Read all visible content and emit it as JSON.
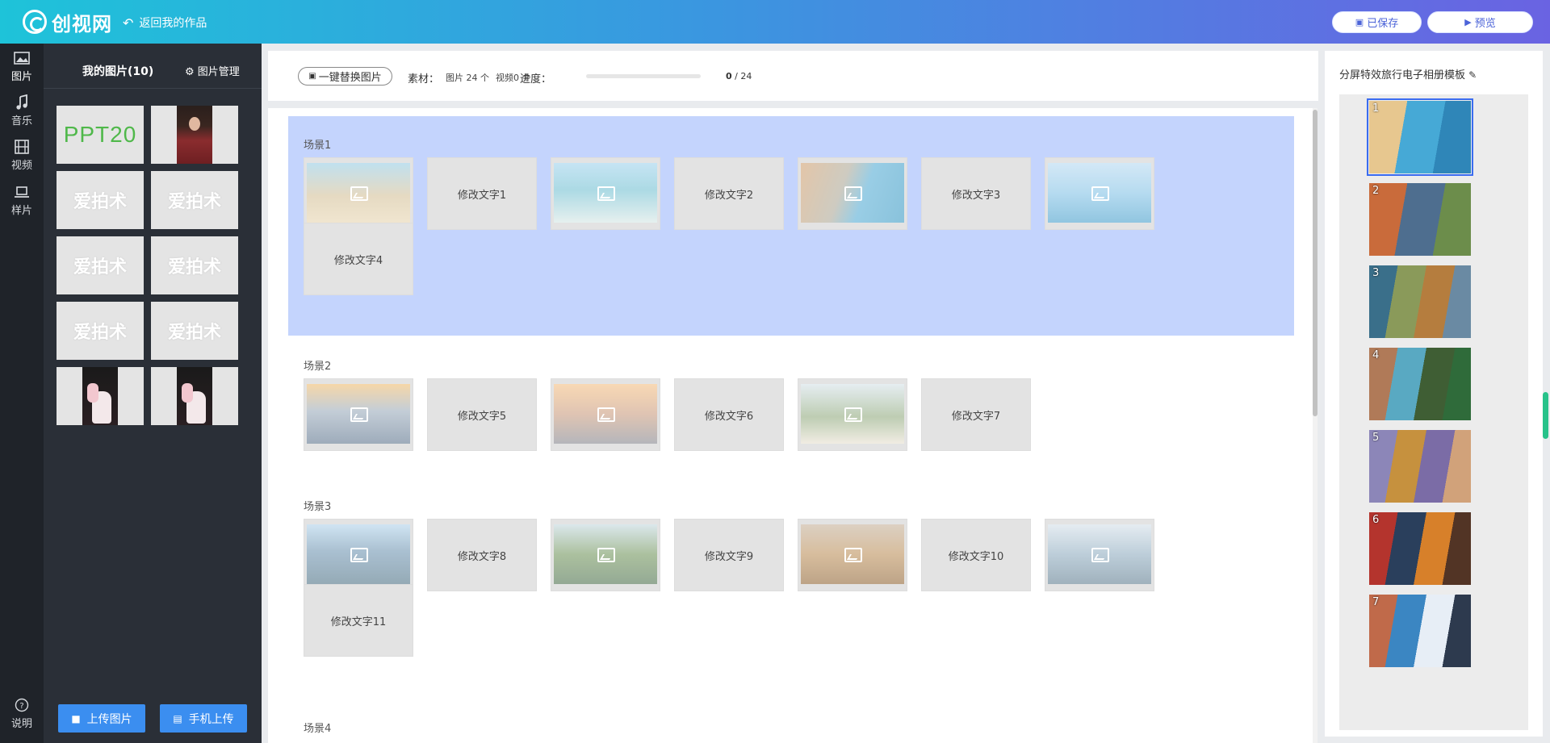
{
  "header": {
    "logo_text": "创视网",
    "back_label": "返回我的作品",
    "saved_label": "已保存",
    "preview_label": "预览",
    "accent_color": "#3b63d8"
  },
  "iconbar": {
    "items": [
      {
        "label": "图片",
        "icon": "image-icon"
      },
      {
        "label": "音乐",
        "icon": "music-icon"
      },
      {
        "label": "视频",
        "icon": "film-icon"
      },
      {
        "label": "样片",
        "icon": "laptop-icon"
      }
    ],
    "help_label": "说明"
  },
  "image_panel": {
    "tab_my_images": "我的图片(10)",
    "tab_manage": "图片管理",
    "thumbs": [
      {
        "kind": "ppt-logo",
        "text": "PPT20"
      },
      {
        "kind": "portrait"
      },
      {
        "kind": "watermark",
        "text": "爱拍术"
      },
      {
        "kind": "watermark",
        "text": "爱拍术"
      },
      {
        "kind": "watermark",
        "text": "爱拍术"
      },
      {
        "kind": "watermark",
        "text": "爱拍术"
      },
      {
        "kind": "watermark",
        "text": "爱拍术"
      },
      {
        "kind": "watermark",
        "text": "爱拍术"
      },
      {
        "kind": "wedding"
      },
      {
        "kind": "wedding"
      }
    ],
    "upload_label": "上传图片",
    "mobile_upload_label": "手机上传"
  },
  "toolbar": {
    "replace_label": "一键替换图片",
    "material_label": "素材：",
    "images_count": "图片 24 个",
    "videos_count": "视频0 个",
    "progress_label": "进度：",
    "progress_done": "0",
    "progress_total": "/ 24",
    "progress_fraction": 0
  },
  "scenes": [
    {
      "title": "场景1",
      "items": [
        {
          "type": "image",
          "theme": "beach-sand"
        },
        {
          "type": "text",
          "label": "修改文字1"
        },
        {
          "type": "image",
          "theme": "lagoon"
        },
        {
          "type": "text",
          "label": "修改文字2"
        },
        {
          "type": "image",
          "theme": "coast-town"
        },
        {
          "type": "text",
          "label": "修改文字3"
        },
        {
          "type": "image",
          "theme": "sea-sky"
        },
        {
          "type": "text",
          "label": "修改文字4"
        }
      ]
    },
    {
      "title": "场景2",
      "items": [
        {
          "type": "image",
          "theme": "sunset-hills"
        },
        {
          "type": "text",
          "label": "修改文字5"
        },
        {
          "type": "image",
          "theme": "city-dawn"
        },
        {
          "type": "text",
          "label": "修改文字6"
        },
        {
          "type": "image",
          "theme": "palms"
        },
        {
          "type": "text",
          "label": "修改文字7"
        }
      ]
    },
    {
      "title": "场景3",
      "items": [
        {
          "type": "image",
          "theme": "city-bay"
        },
        {
          "type": "text",
          "label": "修改文字8"
        },
        {
          "type": "image",
          "theme": "castle-lake"
        },
        {
          "type": "text",
          "label": "修改文字9"
        },
        {
          "type": "image",
          "theme": "desert"
        },
        {
          "type": "text",
          "label": "修改文字10"
        },
        {
          "type": "image",
          "theme": "glacier"
        },
        {
          "type": "text",
          "label": "修改文字11"
        }
      ]
    },
    {
      "title": "场景4",
      "items": []
    }
  ],
  "template_panel": {
    "title": "分屏特效旅行电子相册模板",
    "edit_icon": "pencil-icon",
    "slides": [
      {
        "num": "1",
        "selected": true,
        "palette": [
          "#e7c78f",
          "#46a9d6",
          "#2f86b8"
        ]
      },
      {
        "num": "2",
        "selected": false,
        "palette": [
          "#c96b3b",
          "#4e6e8f",
          "#6c8d4b"
        ]
      },
      {
        "num": "3",
        "selected": false,
        "palette": [
          "#3a6f8a",
          "#8a9a5a",
          "#b57d3e",
          "#6a8aa3"
        ]
      },
      {
        "num": "4",
        "selected": false,
        "palette": [
          "#b07a58",
          "#59a9c2",
          "#3f5e34",
          "#2f6b3a"
        ]
      },
      {
        "num": "5",
        "selected": false,
        "palette": [
          "#8c86b8",
          "#c6913e",
          "#7b6ca6",
          "#d1a27a"
        ]
      },
      {
        "num": "6",
        "selected": false,
        "palette": [
          "#b4342d",
          "#2a3f5c",
          "#d7802a",
          "#523425"
        ]
      },
      {
        "num": "7",
        "selected": false,
        "palette": [
          "#c06a4a",
          "#3b86c2",
          "#e7eef6",
          "#2d3a4e"
        ]
      }
    ]
  }
}
